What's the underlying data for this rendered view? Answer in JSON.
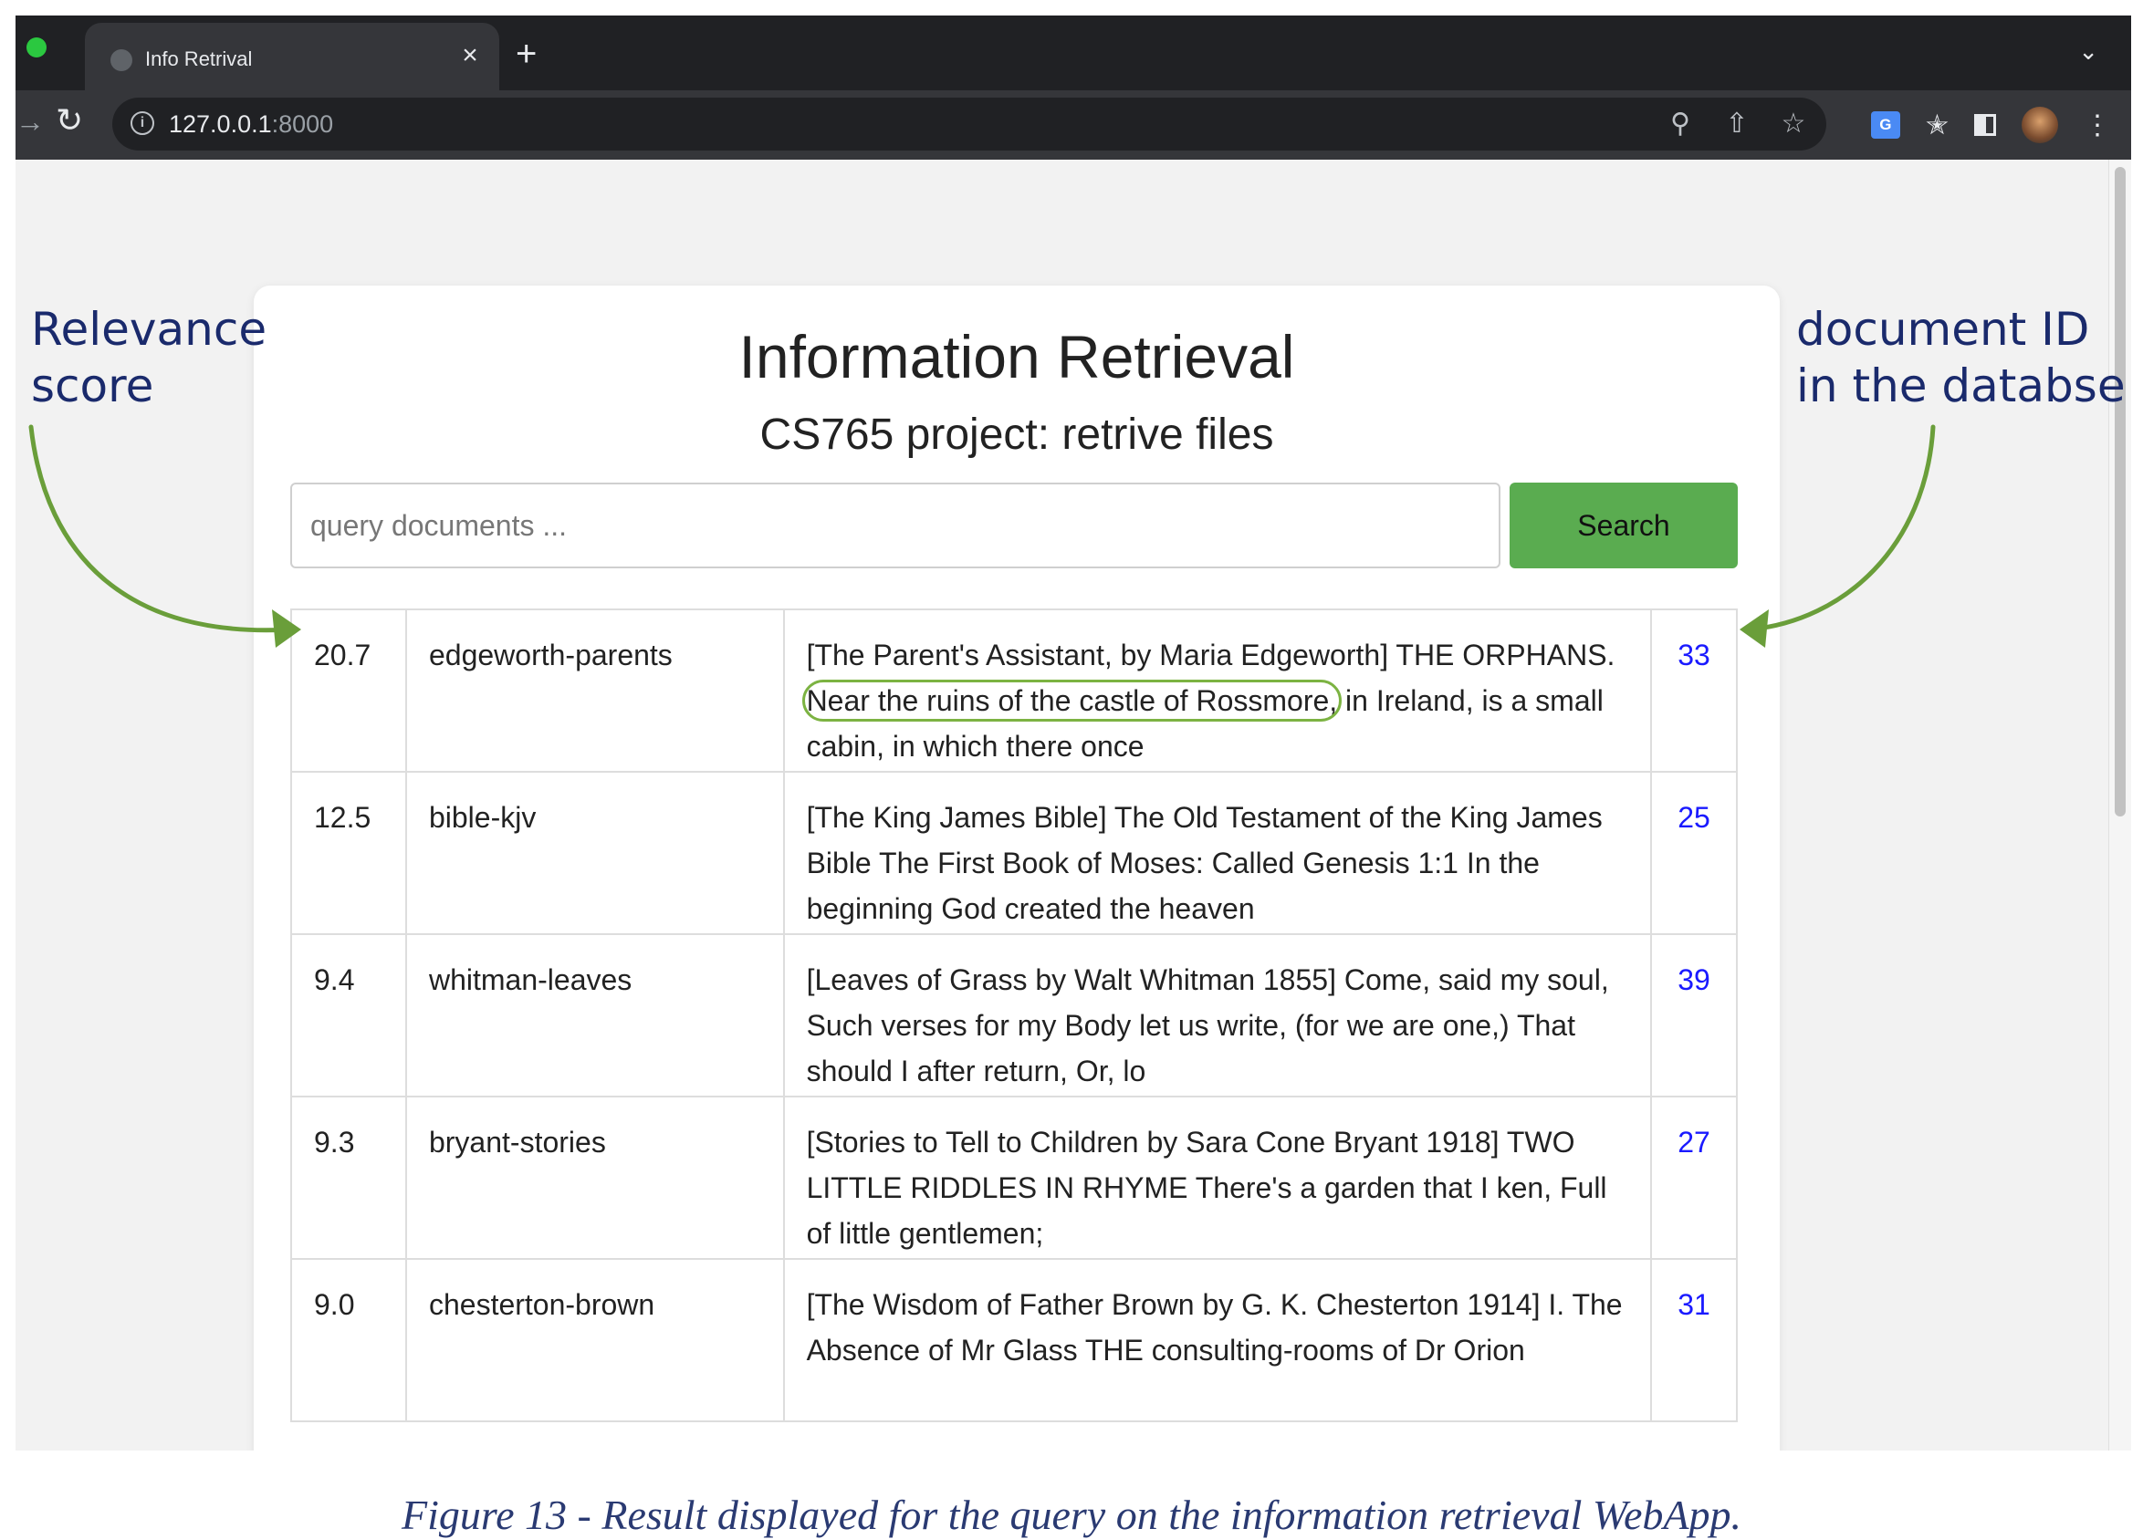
{
  "browser": {
    "tab_title": "Info Retrival",
    "tab_close": "×",
    "new_tab": "+",
    "url_host": "127.0.0.1",
    "url_port": ":8000"
  },
  "page": {
    "title": "Information Retrieval",
    "subtitle": "CS765 project: retrive files",
    "search_placeholder": "query documents ...",
    "search_button": "Search"
  },
  "results": [
    {
      "score": "20.7",
      "name": "edgeworth-parents",
      "text_before": "[The Parent's Assistant, by Maria Edgeworth] THE ORPHANS. ",
      "text_highlight": "Near the ruins of the castle of Rossmore,",
      "text_after": " in Ireland, is a small cabin, in which there once",
      "id": "33"
    },
    {
      "score": "12.5",
      "name": "bible-kjv",
      "text_before": "[The King James Bible] The Old Testament of the King James Bible The First Book of Moses: Called Genesis 1:1 In the beginning God created the heaven",
      "text_highlight": "",
      "text_after": "",
      "id": "25"
    },
    {
      "score": "9.4",
      "name": "whitman-leaves",
      "text_before": "[Leaves of Grass by Walt Whitman 1855] Come, said my soul, Such verses for my Body let us write, (for we are one,) That should I after return, Or, lo",
      "text_highlight": "",
      "text_after": "",
      "id": "39"
    },
    {
      "score": "9.3",
      "name": "bryant-stories",
      "text_before": "[Stories to Tell to Children by Sara Cone Bryant 1918] TWO LITTLE RIDDLES IN RHYME There's a garden that I ken, Full of little gentlemen;",
      "text_highlight": "",
      "text_after": "",
      "id": "27"
    },
    {
      "score": "9.0",
      "name": "chesterton-brown",
      "text_before": "[The Wisdom of Father Brown by G. K. Chesterton 1914] I. The Absence of Mr Glass THE consulting-rooms of Dr Orion",
      "text_highlight": "",
      "text_after": "",
      "id": "31"
    }
  ],
  "annotations": {
    "left_line1": "Relevance",
    "left_line2": "score",
    "right_line1": "document ID",
    "right_line2": "in the databse",
    "arrow_color": "#6a9e3a"
  },
  "caption": "Figure 13 - Result displayed for the query on the information retrieval WebApp."
}
